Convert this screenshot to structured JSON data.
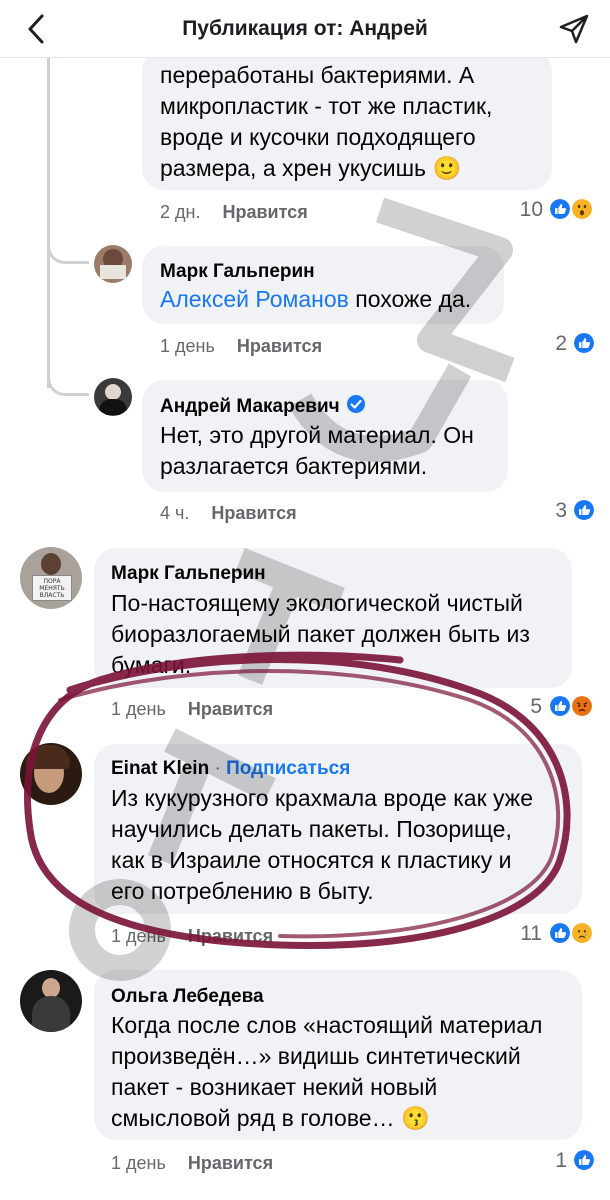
{
  "header": {
    "title": "Публикация от: Андрей"
  },
  "comments": [
    {
      "lines": [
        "переработаны бактериями. А",
        "микропластик - тот же пластик,",
        "вроде и кусочки подходящего",
        "размера, а хрен укусишь"
      ],
      "emoji": "🙂",
      "time": "2 дн.",
      "like_label": "Нравится",
      "reactions_count": "10"
    },
    {
      "author": "Марк Гальперин",
      "mention": "Алексей Романов",
      "text": " похоже да.",
      "time": "1 день",
      "like_label": "Нравится",
      "reactions_count": "2"
    },
    {
      "author": "Андрей Макаревич",
      "lines": [
        "Нет, это другой материал. Он",
        "разлагается бактериями."
      ],
      "time": "4 ч.",
      "like_label": "Нравится",
      "reactions_count": "3"
    },
    {
      "author": "Марк Гальперин",
      "lines": [
        "По-настоящему экологической чистый",
        "биоразлогаемый пакет должен быть из",
        "бумаги."
      ],
      "time": "1 день",
      "like_label": "Нравится",
      "reactions_count": "5",
      "avatar_sign": [
        "ПОРА",
        "МЕНЯТЬ",
        "ВЛАСТЬ"
      ]
    },
    {
      "author": "Einat Klein",
      "separator": " · ",
      "subscribe": "Подписаться",
      "lines": [
        "Из кукурузного крахмала вроде как уже",
        "научились делать пакеты. Позорище,",
        "как в Израиле относятся к пластику и",
        "его потреблению в быту."
      ],
      "time": "1 день",
      "like_label": "Нравится",
      "reactions_count": "11"
    },
    {
      "author": "Ольга Лебедева",
      "lines": [
        "Когда после слов «настоящий материал",
        "произведён…» видишь  синтетический",
        "пакет - возникает некий новый",
        "смысловой ряд в голове…"
      ],
      "emoji": "😗",
      "time": "1 день",
      "like_label": "Нравится",
      "reactions_count": "1"
    }
  ],
  "colors": {
    "link": "#1877f2",
    "like": "#1877f2",
    "angry": "#e9710f",
    "haha": "#f7b125",
    "annotation": "#7a1236"
  },
  "icons": [
    "back-arrow-icon",
    "share-icon",
    "verified-icon",
    "like-reaction-icon",
    "wow-reaction-icon",
    "angry-reaction-icon",
    "sad-reaction-icon"
  ]
}
